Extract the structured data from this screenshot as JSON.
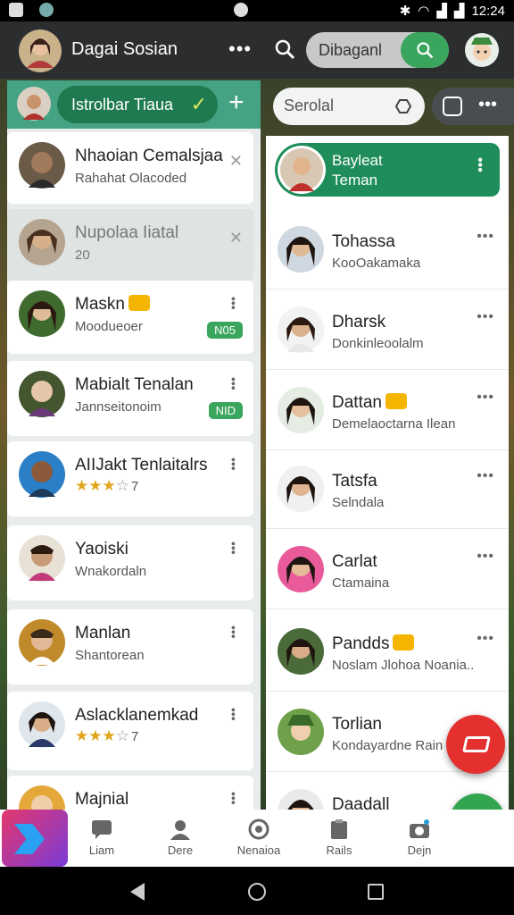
{
  "status_bar": {
    "time": "12:24"
  },
  "app_bar": {
    "title": "Dagai Sosian",
    "more_label": "•••",
    "search_value": "Dibaganl"
  },
  "left_panel": {
    "header_label": "Istrolbar Tiaua",
    "header_check": "✓",
    "add_label": "+",
    "contacts": [
      {
        "name": "Nhaoian Cemalsjaa",
        "sub": "Rahahat Olacoded"
      },
      {
        "name": "Nupolaa Iiatal",
        "sub": "20"
      },
      {
        "name": "Maskn",
        "sub": "Moodueoer",
        "badge": "N05"
      },
      {
        "name": "Mabialt Tenalan",
        "sub": "Jannseitonoim",
        "badge": "NID"
      },
      {
        "name": "AIIJakt Tenlaitalrs",
        "rating": "★★★",
        "rating_empty": "☆",
        "rating_count": "7"
      },
      {
        "name": "Yaoiski",
        "sub": "Wnakordaln"
      },
      {
        "name": "Manlan",
        "sub": "Shantorean"
      },
      {
        "name": "Aslacklanemkad",
        "rating": "★★★",
        "rating_empty": "☆",
        "rating_count": "7"
      },
      {
        "name": "Majnial"
      }
    ]
  },
  "right_panel": {
    "search_placeholder": "Serolal",
    "chat_title": "Bayleat",
    "chat_subtitle": "Teman",
    "chats": [
      {
        "name": "Tohassa",
        "sub": "KooOakamaka"
      },
      {
        "name": "Dharsk",
        "sub": "Donkinleoolalm"
      },
      {
        "name": "Dattan",
        "sub": "Demelaoctarna Ilean"
      },
      {
        "name": "Tatsfa",
        "sub": "Selndala"
      },
      {
        "name": "Carlat",
        "sub": "Ctamaina"
      },
      {
        "name": "Pandds",
        "sub": "Noslam Jlohoa Noania.."
      },
      {
        "name": "Torlian",
        "sub": "Kondayardne Rain"
      },
      {
        "name": "Daadall"
      }
    ]
  },
  "bottom_nav": [
    {
      "label": "Liam"
    },
    {
      "label": "Dere"
    },
    {
      "label": "Nenaioa"
    },
    {
      "label": "Rails"
    },
    {
      "label": "Dejn"
    }
  ],
  "colors": {
    "accent": "#33a551",
    "header": "#2b2d2f",
    "fab_red": "#e53030"
  }
}
